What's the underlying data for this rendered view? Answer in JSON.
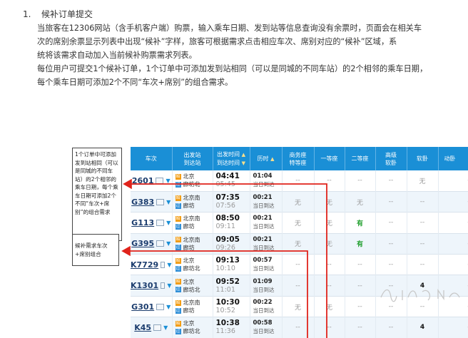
{
  "doc": {
    "title_number": "1.",
    "title": "候补订单提交",
    "paragraphs": [
      "当旅客在12306网站（含手机客户端）购票，输入乘车日期、发到站等信息查询没有余票时，页面会在相关车",
      "次的席别余票显示列表中出现“候补”字样，旅客可根据需求点击相应车次、席别对应的“候补”区域，系",
      "统将该需求自动加入当前候补购票需求列表。",
      "每位用户可提交1个候补订单，1个订单中可添加发到站相同（可以是同城的不同车站）的2个相邻的乘车日期，",
      "每个乘车日期可添加2个不同“车次+席别”的组合需求。"
    ]
  },
  "callouts": {
    "first": "1个订单中可添加发到站相同（可以是同城的不同车站）的2个相邻的乘车日期，每个乘车日期可添加2个不同“车次+席别”的组合需求",
    "second": "候补需求车次+席别组合"
  },
  "table": {
    "headers": {
      "train": "车次",
      "stations_1": "出发站",
      "stations_2": "到达站",
      "times_1": "出发时间",
      "times_2": "到达时间",
      "duration": "历时",
      "business_1": "商务座",
      "business_2": "特等座",
      "first": "一等座",
      "second": "二等座",
      "soft_sleeper_1": "高级",
      "soft_sleeper_2": "软卧",
      "soft": "软卧",
      "move": "动卧"
    },
    "sort_icon": "triangle-up-icon",
    "rows": [
      {
        "train": "2601",
        "from": "北京",
        "to": "廊坊北",
        "dep": "04:41",
        "arr": "05:45",
        "dur": "01:04",
        "day": "当日到达",
        "c1": "--",
        "c2": "--",
        "c3": "--",
        "c4": "--",
        "c5": "无",
        "c6": "--"
      },
      {
        "train": "G383",
        "from": "北京南",
        "to": "廊坊",
        "dep": "07:35",
        "arr": "07:56",
        "dur": "00:21",
        "day": "当日到达",
        "c1": "无",
        "c2": "无",
        "c3": "无",
        "c4": "--",
        "c5": "--",
        "c6": "--"
      },
      {
        "train": "G113",
        "from": "北京南",
        "to": "廊坊",
        "dep": "08:50",
        "arr": "09:11",
        "dur": "00:21",
        "day": "当日到达",
        "c1": "无",
        "c2": "无",
        "c3": "有",
        "c4": "--",
        "c5": "--",
        "c6": "--"
      },
      {
        "train": "G395",
        "from": "北京南",
        "to": "廊坊",
        "dep": "09:05",
        "arr": "09:26",
        "dur": "00:21",
        "day": "当日到达",
        "c1": "无",
        "c2": "无",
        "c3": "有",
        "c4": "--",
        "c5": "--",
        "c6": "--"
      },
      {
        "train": "K7729",
        "from": "北京",
        "to": "廊坊北",
        "dep": "09:13",
        "arr": "10:10",
        "dur": "00:57",
        "day": "当日到达",
        "c1": "--",
        "c2": "--",
        "c3": "--",
        "c4": "--",
        "c5": "--",
        "c6": "--"
      },
      {
        "train": "K1301",
        "from": "北京",
        "to": "廊坊北",
        "dep": "09:52",
        "arr": "11:01",
        "dur": "01:09",
        "day": "当日到达",
        "c1": "--",
        "c2": "--",
        "c3": "--",
        "c4": "--",
        "c5": "4",
        "c6": "--"
      },
      {
        "train": "G301",
        "from": "北京南",
        "to": "廊坊",
        "dep": "10:30",
        "arr": "10:52",
        "dur": "00:22",
        "day": "当日到达",
        "c1": "无",
        "c2": "无",
        "c3": "--",
        "c4": "--",
        "c5": "--",
        "c6": "--"
      },
      {
        "train": "K45",
        "from": "北京",
        "to": "廊坊北",
        "dep": "10:38",
        "arr": "11:36",
        "dur": "00:58",
        "day": "当日到达",
        "c1": "--",
        "c2": "--",
        "c3": "--",
        "c4": "--",
        "c5": "4",
        "c6": "--"
      }
    ]
  },
  "colors": {
    "header_blue": "#1a8fd6",
    "annotation_red": "#e0231b",
    "available_green": "#1f9e2c"
  }
}
